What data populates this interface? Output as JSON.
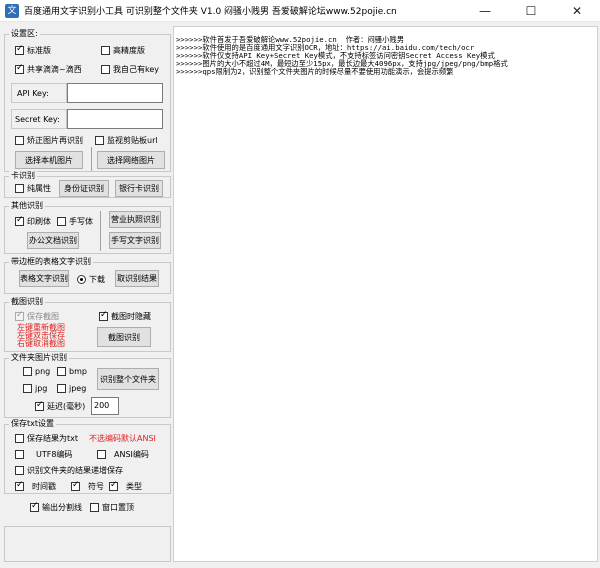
{
  "window": {
    "title": "百度通用文字识别小工具 可识别整个文件夹 V1.0   闷骚小贱男    吾爱破解论坛www.52pojie.cn",
    "app_icon": "文",
    "minimize_glyph": "—",
    "maximize_glyph": "☐",
    "close_glyph": "✕"
  },
  "settings": {
    "group_title": "设置区:",
    "standard_label": "标准版",
    "standard_checked": true,
    "hd_label": "高精度版",
    "hd_checked": false,
    "shared_label": "共享滴滴~滴西",
    "shared_checked": true,
    "ownkey_label": "我自己有key",
    "ownkey_checked": false,
    "apikey_label": "API Key:",
    "apikey_value": "",
    "secretkey_label": "Secret Key:",
    "secretkey_value": "",
    "correct_label": "矫正图片再识别",
    "correct_checked": false,
    "clipboard_label": "监视剪贴板url",
    "clipboard_checked": false,
    "local_btn": "选择本机图片",
    "web_btn": "选择网络图片"
  },
  "card": {
    "group_title": "卡识别",
    "pure_label": "纯属性",
    "pure_checked": false,
    "idcard_btn": "身份证识别",
    "bankcard_btn": "银行卡识别"
  },
  "other": {
    "group_title": "其他识别",
    "print_label": "印刷体",
    "print_checked": true,
    "hand_label": "手写体",
    "hand_checked": false,
    "office_btn": "办公文档识别",
    "license_btn": "营业执照识别",
    "handwrite_btn": "手写文字识别"
  },
  "table": {
    "group_title": "带边框的表格文字识别",
    "table_btn": "表格文字识别",
    "download_label": "下载",
    "download_selected": true,
    "result_btn": "取识别结果"
  },
  "screenshot": {
    "group_title": "截图识别",
    "save_label": "保存截图",
    "save_checked": true,
    "hide_label": "截图时隐藏",
    "hide_checked": true,
    "hint_lines": [
      "左键重新截图",
      "左键双击保存",
      "右键取消截图"
    ],
    "shot_btn": "截图识别"
  },
  "folder": {
    "group_title": "文件夹图片识别",
    "png_label": "png",
    "bmp_label": "bmp",
    "jpg_label": "jpg",
    "jpeg_label": "jpeg",
    "folder_btn": "识别整个文件夹",
    "delay_label": "延迟(毫秒)",
    "delay_checked": true,
    "delay_value": "200"
  },
  "txt": {
    "group_title": "保存txt设置",
    "savetxt_label": "保存结果为txt",
    "savetxt_checked": false,
    "ansi_note": "不选编码默认ANSI",
    "utf8_label": "UTF8编码",
    "utf8_checked": false,
    "ansi_label": "ANSI编码",
    "ansi_checked": false,
    "folder_result_label": "识别文件夹的结果递增保存",
    "folder_result_checked": false,
    "timestamp_label": "时间戳",
    "timestamp_checked": true,
    "symbol_label": "符号",
    "symbol_checked": true,
    "type_label": "类型",
    "type_checked": true
  },
  "bottom": {
    "divider_label": "输出分割线",
    "divider_checked": true,
    "topmost_label": "窗口置顶",
    "topmost_checked": false
  },
  "log": {
    "lines": [
      ">>>>>>软件首发于吾爱破解论www.52pojie.cn  作者：闷骚小贱男",
      ">>>>>>软件使用的是百度通用文字识别OCR，地址：https://ai.baidu.com/tech/ocr",
      ">>>>>>软件仅支持API Key+Secret Key模式，不支持标签访问密钥Secret Access Key模式",
      ">>>>>>图片的大小不超过4M，最短边至少15px，最长边最大4096px，支持jpg/jpeg/png/bmp格式",
      ">>>>>>qps限制为2，识别整个文件夹图片的时候尽量不要使用功能演示，会提示频繁"
    ]
  }
}
